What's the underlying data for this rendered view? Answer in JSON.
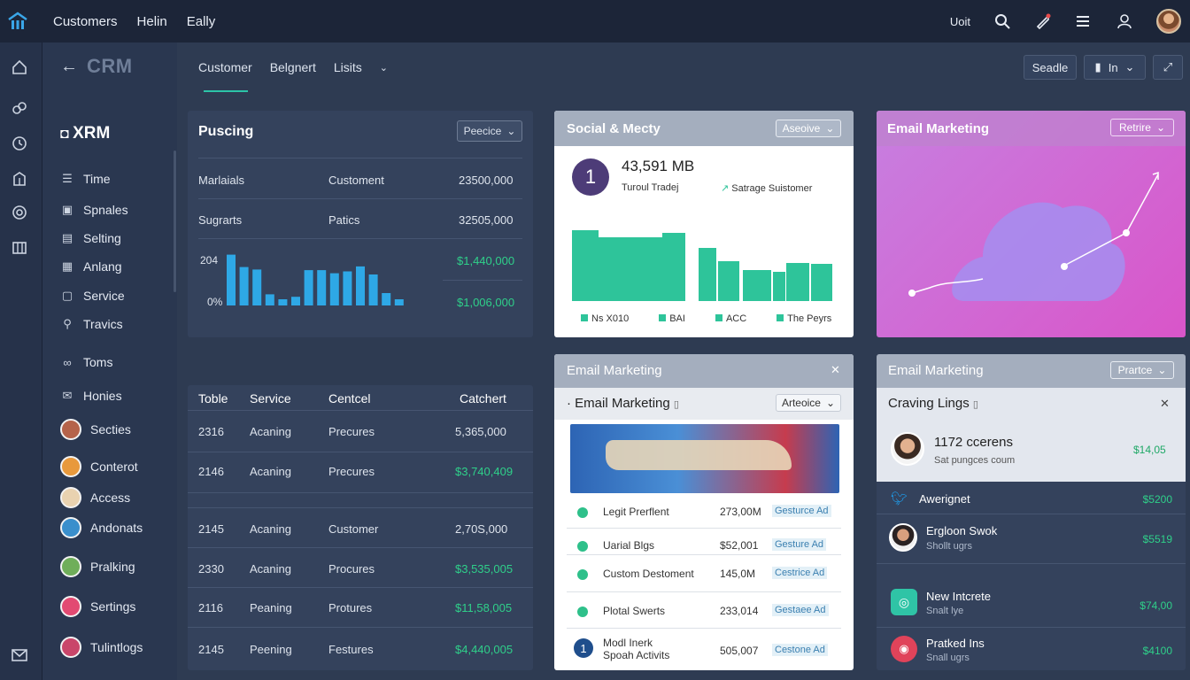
{
  "topbar": {
    "nav": [
      "Customers",
      "Helin",
      "Eally"
    ],
    "right_text": "Uoit",
    "icons": [
      "search-icon",
      "rocket-icon",
      "menu-icon",
      "user-icon"
    ]
  },
  "header": {
    "title": "CRM",
    "tabs": [
      "Customer",
      "Belgnert",
      "Lisits"
    ],
    "btn_seadle": "Seadle",
    "btn_in": "In"
  },
  "sidebar": {
    "brand": "XRM",
    "items": [
      "Time",
      "Spnales",
      "Selting",
      "Anlang",
      "Service",
      "Travics",
      "Toms",
      "Honies",
      "Secties",
      "Conterot",
      "Access",
      "Andonats",
      "Pralking",
      "Sertings",
      "Tulintlogs"
    ]
  },
  "pricing": {
    "title": "Puscing",
    "dropdown": "Peecice",
    "row1": [
      "Marlaials",
      "Customent",
      "23500,000"
    ],
    "row2": [
      "Sugrarts",
      "Patics",
      "32505,000"
    ],
    "axis_top": "204",
    "axis_bottom": "0%",
    "val_a": "$1,440,000",
    "val_b": "$1,006,000",
    "bars": [
      0.82,
      0.62,
      0.58,
      0.18,
      0.1,
      0.14,
      0.57,
      0.57,
      0.52,
      0.55,
      0.63,
      0.5,
      0.2,
      0.1
    ]
  },
  "table": {
    "headers": [
      "Toble",
      "Service",
      "Centcel",
      "Catchert"
    ],
    "rows": [
      [
        "2316",
        "Acaning",
        "Precures",
        "5,365,000"
      ],
      [
        "2146",
        "Acaning",
        "Precures",
        "$3,740,409"
      ],
      [
        "2145",
        "Acaning",
        "Customer",
        "2,70S,000"
      ],
      [
        "2330",
        "Acaning",
        "Procures",
        "$3,535,005"
      ],
      [
        "2116",
        "Peaning",
        "Protures",
        "$11,58,005"
      ],
      [
        "2145",
        "Peening",
        "Festures",
        "$4,440,005"
      ]
    ]
  },
  "social": {
    "title": "Social & Mecty",
    "dropdown": "Aseoive",
    "badge": "1",
    "big_value": "43,591 MB",
    "sub1": "Turoul Tradej",
    "sub2": "Satrage Suistomer",
    "bars": [
      0.8,
      0.72,
      0.77,
      0.0,
      0.6,
      0.45,
      0.35,
      0.33,
      0.43,
      0.42
    ],
    "legend": [
      "Ns X010",
      "BAI",
      "ACC",
      "The Peyrs"
    ],
    "legend_color": "#2ec49a"
  },
  "email_top": {
    "title": "Email Marketing",
    "dropdown": "Retrire",
    "color_a": "#c77fe0",
    "color_b": "#d955c9"
  },
  "email_mid": {
    "title": "Email Marketing",
    "inner_title": "Email Marketing",
    "dropdown": "Arteoice",
    "rows": [
      {
        "label": "Legit Prerflent",
        "value": "273,00M",
        "tag": "Gesturce Ad"
      },
      {
        "label": "Uarial Blgs",
        "value": "$52,001",
        "tag": "Gesture Ad"
      },
      {
        "label": "Custom Destoment",
        "value": "145,0M",
        "tag": "Cestrice Ad"
      },
      {
        "label": "Plotal Swerts",
        "value": "233,014",
        "tag": "Gestaee Ad"
      },
      {
        "label": "Modl Inerk",
        "label2": "Spoah Activits",
        "value": "505,007",
        "tag": "Cestone Ad",
        "badge": "1"
      }
    ]
  },
  "email_right": {
    "title": "Email Marketing",
    "dropdown": "Prartce",
    "section": "Craving Lings",
    "top_item": {
      "title": "1172 ccerens",
      "sub": "Sat pungces coum",
      "value": "$14,05"
    },
    "rows": [
      {
        "title": "Awerignet",
        "sub": "",
        "value": "$5200"
      },
      {
        "title": "Ergloon Swok",
        "sub": "Shollt ugrs",
        "value": "$5519"
      },
      {
        "title": "New Intcrete",
        "sub": "Snalt lye",
        "value": "$74,00"
      },
      {
        "title": "Pratked Ins",
        "sub": "Snall ugrs",
        "value": "$4100"
      }
    ]
  }
}
